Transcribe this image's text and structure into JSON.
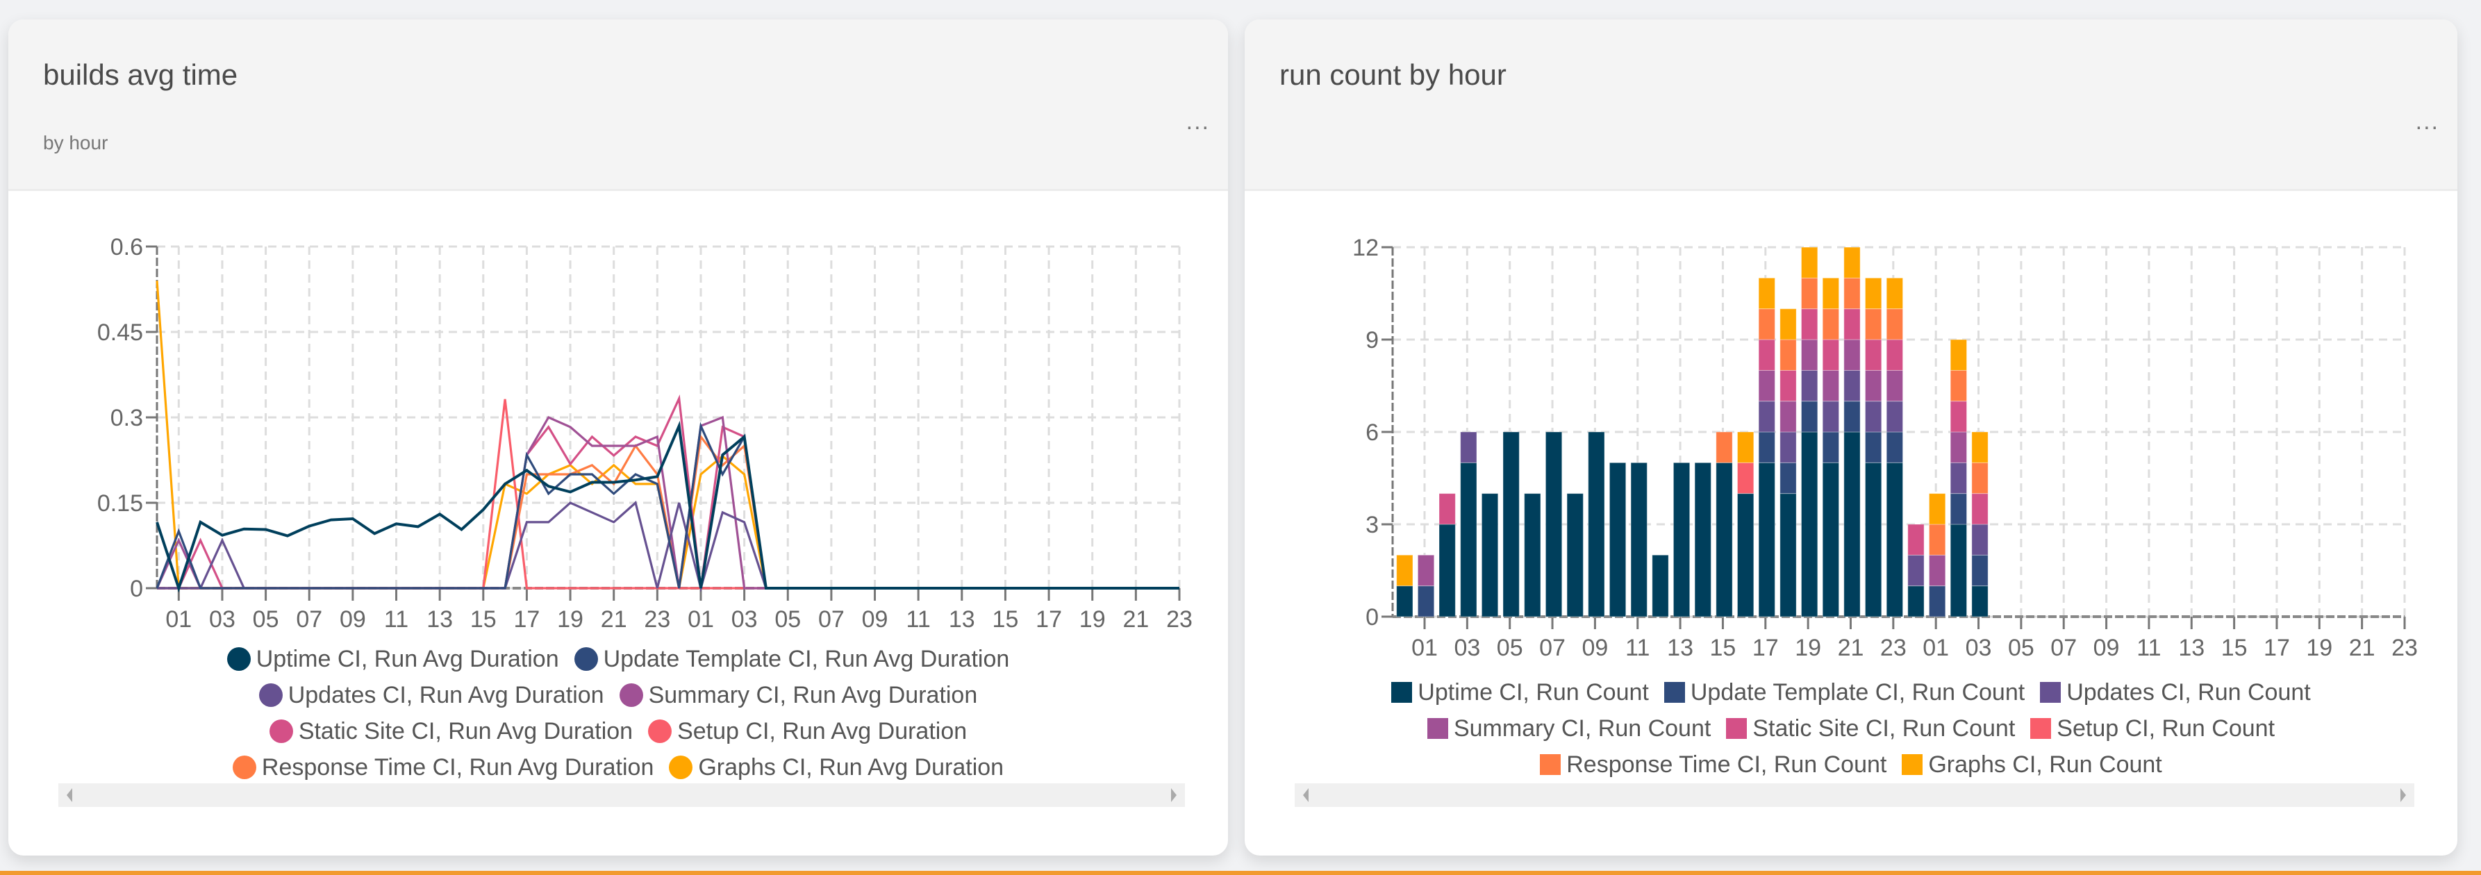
{
  "cards": [
    {
      "title": "builds avg time",
      "subtitle": "by hour",
      "menu_label": "..."
    },
    {
      "title": "run count by hour",
      "subtitle": "",
      "menu_label": "..."
    }
  ],
  "chart_data": [
    {
      "type": "line",
      "title": "builds avg time",
      "subtitle": "by hour",
      "xlabel": "",
      "ylabel": "",
      "ylim": [
        0,
        0.6
      ],
      "yticks": [
        "0",
        "0.15",
        "0.3",
        "0.45",
        "0.6"
      ],
      "ytick_values": [
        0,
        0.15,
        0.3,
        0.45,
        0.6
      ],
      "x_count": 48,
      "x_tick_labels": [
        "01",
        "03",
        "05",
        "07",
        "09",
        "11",
        "13",
        "15",
        "17",
        "19",
        "21",
        "23",
        "01",
        "03",
        "05",
        "07",
        "09",
        "11",
        "13",
        "15",
        "17",
        "19",
        "21",
        "23"
      ],
      "grid": true,
      "legend_position": "bottom",
      "series": [
        {
          "name": "Uptime CI, Run Avg Duration",
          "color": "#003f5c",
          "values": [
            0.116,
            0,
            0.116,
            0.093,
            0.104,
            0.103,
            0.092,
            0.109,
            0.12,
            0.122,
            0.096,
            0.113,
            0.108,
            0.13,
            0.103,
            0.138,
            0.183,
            0.207,
            0.179,
            0.169,
            0.186,
            0.186,
            0.19,
            0.196,
            0.285,
            0,
            0.234,
            0.266,
            0,
            0,
            0,
            0,
            0,
            0,
            0,
            0,
            0,
            0,
            0,
            0,
            0,
            0,
            0,
            0,
            0,
            0,
            0,
            0
          ]
        },
        {
          "name": "Update Template CI, Run Avg Duration",
          "color": "#2f4b7c",
          "values": [
            0,
            0.1,
            0,
            0,
            0,
            0,
            0,
            0,
            0,
            0,
            0,
            0,
            0,
            0,
            0,
            0,
            0,
            0.234,
            0.166,
            0.2,
            0.2,
            0.166,
            0.2,
            0.183,
            0,
            0.285,
            0.2,
            0.266,
            0,
            0,
            0,
            0,
            0,
            0,
            0,
            0,
            0,
            0,
            0,
            0,
            0,
            0,
            0,
            0,
            0,
            0,
            0,
            0
          ]
        },
        {
          "name": "Updates CI, Run Avg Duration",
          "color": "#665191",
          "values": [
            0,
            0,
            0,
            0.084,
            0,
            0,
            0,
            0,
            0,
            0,
            0,
            0,
            0,
            0,
            0,
            0,
            0,
            0.116,
            0.116,
            0.15,
            0.133,
            0.116,
            0.15,
            0,
            0.15,
            0,
            0.133,
            0.116,
            0,
            0,
            0,
            0,
            0,
            0,
            0,
            0,
            0,
            0,
            0,
            0,
            0,
            0,
            0,
            0,
            0,
            0,
            0,
            0
          ]
        },
        {
          "name": "Summary CI, Run Avg Duration",
          "color": "#a05195",
          "values": [
            0,
            0.084,
            0,
            0,
            0,
            0,
            0,
            0,
            0,
            0,
            0,
            0,
            0,
            0,
            0,
            0,
            0,
            0.234,
            0.3,
            0.283,
            0.25,
            0.25,
            0.25,
            0.266,
            0,
            0.285,
            0.3,
            0,
            0,
            0,
            0,
            0,
            0,
            0,
            0,
            0,
            0,
            0,
            0,
            0,
            0,
            0,
            0,
            0,
            0,
            0,
            0,
            0
          ]
        },
        {
          "name": "Static Site CI, Run Avg Duration",
          "color": "#d45087",
          "values": [
            0,
            0,
            0.084,
            0,
            0,
            0,
            0,
            0,
            0,
            0,
            0,
            0,
            0,
            0,
            0,
            0,
            0,
            0.234,
            0.283,
            0.218,
            0.266,
            0.233,
            0.266,
            0.25,
            0.333,
            0,
            0.283,
            0.266,
            0,
            0,
            0,
            0,
            0,
            0,
            0,
            0,
            0,
            0,
            0,
            0,
            0,
            0,
            0,
            0,
            0,
            0,
            0,
            0
          ]
        },
        {
          "name": "Setup CI, Run Avg Duration",
          "color": "#f95d6a",
          "values": [
            0,
            0,
            0,
            0,
            0,
            0,
            0,
            0,
            0,
            0,
            0,
            0,
            0,
            0,
            0,
            0,
            0.332,
            0,
            0,
            0,
            0,
            0,
            0,
            0,
            0,
            0,
            0,
            0,
            0,
            0,
            0,
            0,
            0,
            0,
            0,
            0,
            0,
            0,
            0,
            0,
            0,
            0,
            0,
            0,
            0,
            0,
            0,
            0
          ]
        },
        {
          "name": "Response Time CI, Run Avg Duration",
          "color": "#ff7c43",
          "values": [
            0,
            0,
            0,
            0,
            0,
            0,
            0,
            0,
            0,
            0,
            0,
            0,
            0,
            0,
            0,
            0,
            0,
            0.2,
            0.2,
            0.2,
            0.216,
            0.183,
            0.25,
            0.2,
            0,
            0.266,
            0.216,
            0.25,
            0,
            0,
            0,
            0,
            0,
            0,
            0,
            0,
            0,
            0,
            0,
            0,
            0,
            0,
            0,
            0,
            0,
            0,
            0,
            0
          ]
        },
        {
          "name": "Graphs CI, Run Avg Duration",
          "color": "#ffa600",
          "values": [
            0.54,
            0,
            0,
            0,
            0,
            0,
            0,
            0,
            0,
            0,
            0,
            0,
            0,
            0,
            0,
            0,
            0.183,
            0.166,
            0.2,
            0.216,
            0.183,
            0.216,
            0.183,
            0.183,
            0,
            0.2,
            0.232,
            0.2,
            0,
            0,
            0,
            0,
            0,
            0,
            0,
            0,
            0,
            0,
            0,
            0,
            0,
            0,
            0,
            0,
            0,
            0,
            0,
            0
          ]
        }
      ]
    },
    {
      "type": "bar",
      "stacked": true,
      "title": "run count by hour",
      "xlabel": "",
      "ylabel": "",
      "ylim": [
        0,
        12
      ],
      "yticks": [
        "0",
        "3",
        "6",
        "9",
        "12"
      ],
      "ytick_values": [
        0,
        3,
        6,
        9,
        12
      ],
      "x_count": 48,
      "x_tick_labels": [
        "01",
        "03",
        "05",
        "07",
        "09",
        "11",
        "13",
        "15",
        "17",
        "19",
        "21",
        "23",
        "01",
        "03",
        "05",
        "07",
        "09",
        "11",
        "13",
        "15",
        "17",
        "19",
        "21",
        "23"
      ],
      "grid": true,
      "legend_position": "bottom",
      "series": [
        {
          "name": "Uptime CI, Run Count",
          "color": "#003f5c",
          "values": [
            1,
            0,
            3,
            5,
            4,
            6,
            4,
            6,
            4,
            6,
            5,
            5,
            2,
            5,
            5,
            5,
            4,
            5,
            4,
            6,
            5,
            6,
            5,
            5,
            1,
            0,
            3,
            1,
            0,
            0,
            0,
            0,
            0,
            0,
            0,
            0,
            0,
            0,
            0,
            0,
            0,
            0,
            0,
            0,
            0,
            0,
            0,
            0
          ]
        },
        {
          "name": "Update Template CI, Run Count",
          "color": "#2f4b7c",
          "values": [
            0,
            1,
            0,
            0,
            0,
            0,
            0,
            0,
            0,
            0,
            0,
            0,
            0,
            0,
            0,
            0,
            0,
            1,
            1,
            1,
            1,
            1,
            1,
            1,
            0,
            1,
            1,
            1,
            0,
            0,
            0,
            0,
            0,
            0,
            0,
            0,
            0,
            0,
            0,
            0,
            0,
            0,
            0,
            0,
            0,
            0,
            0,
            0
          ]
        },
        {
          "name": "Updates CI, Run Count",
          "color": "#665191",
          "values": [
            0,
            0,
            0,
            1,
            0,
            0,
            0,
            0,
            0,
            0,
            0,
            0,
            0,
            0,
            0,
            0,
            0,
            1,
            1,
            1,
            1,
            1,
            1,
            1,
            1,
            0,
            1,
            1,
            0,
            0,
            0,
            0,
            0,
            0,
            0,
            0,
            0,
            0,
            0,
            0,
            0,
            0,
            0,
            0,
            0,
            0,
            0,
            0
          ]
        },
        {
          "name": "Summary CI, Run Count",
          "color": "#a05195",
          "values": [
            0,
            1,
            0,
            0,
            0,
            0,
            0,
            0,
            0,
            0,
            0,
            0,
            0,
            0,
            0,
            0,
            0,
            1,
            1,
            1,
            1,
            1,
            1,
            1,
            0,
            1,
            1,
            0,
            0,
            0,
            0,
            0,
            0,
            0,
            0,
            0,
            0,
            0,
            0,
            0,
            0,
            0,
            0,
            0,
            0,
            0,
            0,
            0
          ]
        },
        {
          "name": "Static Site CI, Run Count",
          "color": "#d45087",
          "values": [
            0,
            0,
            1,
            0,
            0,
            0,
            0,
            0,
            0,
            0,
            0,
            0,
            0,
            0,
            0,
            0,
            0,
            1,
            1,
            1,
            1,
            1,
            1,
            1,
            1,
            0,
            1,
            1,
            0,
            0,
            0,
            0,
            0,
            0,
            0,
            0,
            0,
            0,
            0,
            0,
            0,
            0,
            0,
            0,
            0,
            0,
            0,
            0
          ]
        },
        {
          "name": "Setup CI, Run Count",
          "color": "#f95d6a",
          "values": [
            0,
            0,
            0,
            0,
            0,
            0,
            0,
            0,
            0,
            0,
            0,
            0,
            0,
            0,
            0,
            0,
            1,
            0,
            0,
            0,
            0,
            0,
            0,
            0,
            0,
            0,
            0,
            0,
            0,
            0,
            0,
            0,
            0,
            0,
            0,
            0,
            0,
            0,
            0,
            0,
            0,
            0,
            0,
            0,
            0,
            0,
            0,
            0
          ]
        },
        {
          "name": "Response Time CI, Run Count",
          "color": "#ff7c43",
          "values": [
            0,
            0,
            0,
            0,
            0,
            0,
            0,
            0,
            0,
            0,
            0,
            0,
            0,
            0,
            0,
            1,
            0,
            1,
            1,
            1,
            1,
            1,
            1,
            1,
            0,
            1,
            1,
            1,
            0,
            0,
            0,
            0,
            0,
            0,
            0,
            0,
            0,
            0,
            0,
            0,
            0,
            0,
            0,
            0,
            0,
            0,
            0,
            0
          ]
        },
        {
          "name": "Graphs CI, Run Count",
          "color": "#ffa600",
          "values": [
            1,
            0,
            0,
            0,
            0,
            0,
            0,
            0,
            0,
            0,
            0,
            0,
            0,
            0,
            0,
            0,
            1,
            1,
            1,
            1,
            1,
            1,
            1,
            1,
            0,
            1,
            1,
            1,
            0,
            0,
            0,
            0,
            0,
            0,
            0,
            0,
            0,
            0,
            0,
            0,
            0,
            0,
            0,
            0,
            0,
            0,
            0,
            0
          ]
        }
      ]
    }
  ]
}
